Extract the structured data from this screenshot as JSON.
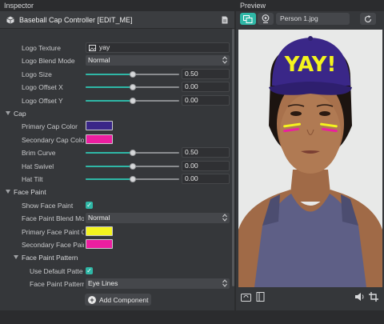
{
  "inspector": {
    "title": "Inspector",
    "component_title": "Baseball Cap Controller [EDIT_ME]",
    "add_component_label": "Add Component",
    "rows": [
      {
        "kind": "texture",
        "label": "Logo Texture",
        "value": "yay"
      },
      {
        "kind": "select",
        "label": "Logo Blend Mode",
        "value": "Normal"
      },
      {
        "kind": "slider",
        "label": "Logo Size",
        "value": "0.50",
        "fraction": 0.5
      },
      {
        "kind": "slider",
        "label": "Logo Offset X",
        "value": "0.00",
        "fraction": 0.5
      },
      {
        "kind": "slider",
        "label": "Logo Offset Y",
        "value": "0.00",
        "fraction": 0.5
      },
      {
        "kind": "section",
        "label": "Cap"
      },
      {
        "kind": "color",
        "label": "Primary Cap Color",
        "color": "#3a2788"
      },
      {
        "kind": "color",
        "label": "Secondary Cap Colo",
        "color": "#ec1ea0"
      },
      {
        "kind": "slider",
        "label": "Brim Curve",
        "value": "0.50",
        "fraction": 0.5
      },
      {
        "kind": "slider",
        "label": "Hat Swivel",
        "value": "0.00",
        "fraction": 0.5
      },
      {
        "kind": "slider",
        "label": "Hat Tilt",
        "value": "0.00",
        "fraction": 0.5
      },
      {
        "kind": "section",
        "label": "Face Paint"
      },
      {
        "kind": "checkbox",
        "label": "Show Face Paint",
        "checked": true
      },
      {
        "kind": "select",
        "label": "Face Paint Blend Mo",
        "value": "Normal"
      },
      {
        "kind": "color",
        "label": "Primary Face Paint C",
        "color": "#f4f41e"
      },
      {
        "kind": "color",
        "label": "Secondary Face Pair",
        "color": "#ec1ea0"
      },
      {
        "kind": "subsection",
        "label": "Face Paint Pattern"
      },
      {
        "kind": "checkbox-nested",
        "label": "Use Default Patte",
        "checked": true
      },
      {
        "kind": "select-nested",
        "label": "Face Paint Pattern",
        "value": "Eye Lines"
      }
    ]
  },
  "preview": {
    "title": "Preview",
    "filename": "Person 1.jpg",
    "hat_text": "YAY!"
  },
  "colors": {
    "accent": "#2fb7a6",
    "panel": "#35373a",
    "field": "#2f3033"
  }
}
